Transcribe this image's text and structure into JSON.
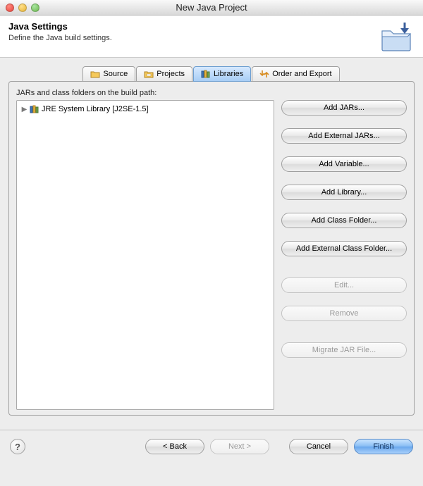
{
  "window": {
    "title": "New Java Project"
  },
  "header": {
    "title": "Java Settings",
    "description": "Define the Java build settings."
  },
  "tabs": {
    "source": "Source",
    "projects": "Projects",
    "libraries": "Libraries",
    "order_export": "Order and Export",
    "active": "libraries"
  },
  "content": {
    "label": "JARs and class folders on the build path:",
    "tree_items": [
      {
        "label": "JRE System Library [J2SE-1.5]"
      }
    ],
    "buttons": {
      "add_jars": "Add JARs...",
      "add_external_jars": "Add External JARs...",
      "add_variable": "Add Variable...",
      "add_library": "Add Library...",
      "add_class_folder": "Add Class Folder...",
      "add_external_class_folder": "Add External Class Folder...",
      "edit": "Edit...",
      "remove": "Remove",
      "migrate": "Migrate JAR File..."
    }
  },
  "footer": {
    "back": "< Back",
    "next": "Next >",
    "cancel": "Cancel",
    "finish": "Finish"
  }
}
